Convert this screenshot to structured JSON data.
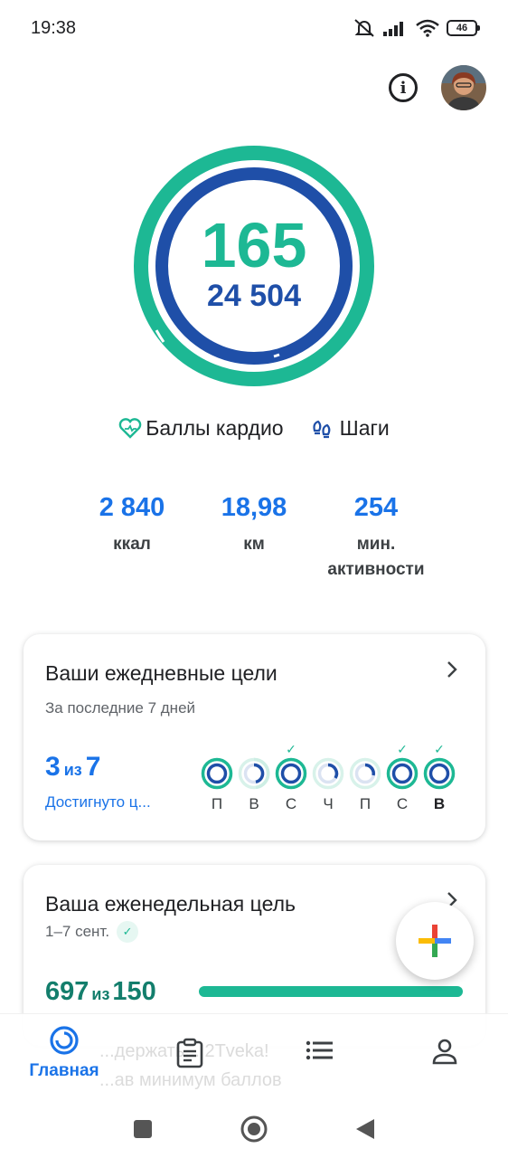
{
  "status_bar": {
    "time": "19:38",
    "battery": "46"
  },
  "ring": {
    "points": "165",
    "steps": "24 504"
  },
  "legend": {
    "cardio": "Баллы кардио",
    "steps": "Шаги"
  },
  "stats": [
    {
      "value": "2 840",
      "label": "ккал"
    },
    {
      "value": "18,98",
      "label": "км"
    },
    {
      "value": "254",
      "label": "мин. активности"
    }
  ],
  "daily_goals": {
    "title": "Ваши ежедневные цели",
    "subtitle": "За последние 7 дней",
    "achieved": "3",
    "of": "из",
    "total": "7",
    "status": "Достигнуто ц...",
    "days": [
      {
        "label": "П",
        "checked": false
      },
      {
        "label": "В",
        "checked": false
      },
      {
        "label": "С",
        "checked": true
      },
      {
        "label": "Ч",
        "checked": false
      },
      {
        "label": "П",
        "checked": false
      },
      {
        "label": "С",
        "checked": true
      },
      {
        "label": "В",
        "checked": true
      }
    ]
  },
  "weekly_goal": {
    "title": "Ваша еженедельная цель",
    "date_range": "1–7 сент.",
    "value": "697",
    "of": "из",
    "target": "150",
    "progress": 1.0
  },
  "nav": {
    "home": "Главная",
    "ghost_line1": "...держать... 2Tveka!",
    "ghost_line2": "...ав минимум баллов"
  },
  "colors": {
    "teal": "#1db894",
    "blue": "#1f4fa8",
    "accent": "#1a73e8"
  }
}
